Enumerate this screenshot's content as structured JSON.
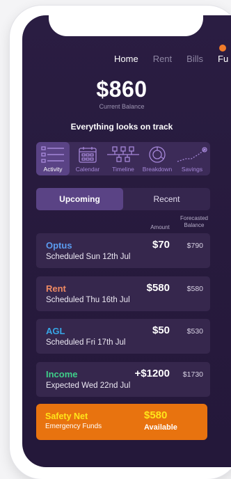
{
  "nav": {
    "tabs": [
      "Home",
      "Rent",
      "Bills",
      "Fu"
    ],
    "active": "Home"
  },
  "balance": {
    "amount": "$860",
    "label": "Current Balance"
  },
  "status": "Everything looks on track",
  "icon_tabs": [
    {
      "label": "Activity",
      "icon": "activity-list-icon"
    },
    {
      "label": "Calendar",
      "icon": "calendar-icon"
    },
    {
      "label": "Timeline",
      "icon": "timeline-icon"
    },
    {
      "label": "Breakdown",
      "icon": "breakdown-donut-icon"
    },
    {
      "label": "Savings",
      "icon": "savings-trend-icon"
    }
  ],
  "segment": {
    "upcoming": "Upcoming",
    "recent": "Recent"
  },
  "columns": {
    "amount": "Amount",
    "forecast_line1": "Forecasted",
    "forecast_line2": "Balance"
  },
  "transactions": [
    {
      "name": "Optus",
      "color": "#5b9cf0",
      "detail": "Scheduled Sun 12th Jul",
      "amount": "$70",
      "forecast": "$790"
    },
    {
      "name": "Rent",
      "color": "#f08a63",
      "detail": "Scheduled Thu 16th Jul",
      "amount": "$580",
      "forecast": "$580"
    },
    {
      "name": "AGL",
      "color": "#37a6e6",
      "detail": "Scheduled Fri 17th Jul",
      "amount": "$50",
      "forecast": "$530"
    },
    {
      "name": "Income",
      "color": "#3fcf8a",
      "detail": "Expected Wed 22nd Jul",
      "amount": "+$1200",
      "forecast": "$1730"
    }
  ],
  "safety_net": {
    "title": "Safety Net",
    "subtitle": "Emergency Funds",
    "amount": "$580",
    "status": "Available"
  },
  "colors": {
    "background": "#271a3d",
    "card": "#36274d",
    "accent": "#5a4385",
    "safety": "#e8730f",
    "highlight": "#ffe51a"
  }
}
